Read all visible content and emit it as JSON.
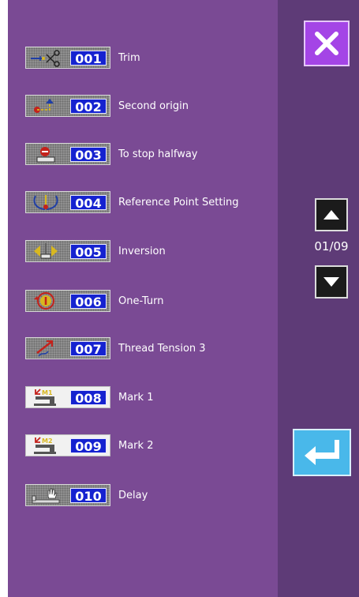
{
  "list": {
    "items": [
      {
        "code": "001",
        "label": "Trim",
        "icon": "scissors-icon"
      },
      {
        "code": "002",
        "label": "Second origin",
        "icon": "second-origin-icon"
      },
      {
        "code": "003",
        "label": "To stop halfway",
        "icon": "stop-halfway-icon"
      },
      {
        "code": "004",
        "label": "Reference Point Setting",
        "icon": "reference-point-icon"
      },
      {
        "code": "005",
        "label": "Inversion",
        "icon": "inversion-icon"
      },
      {
        "code": "006",
        "label": "One-Turn",
        "icon": "one-turn-icon"
      },
      {
        "code": "007",
        "label": "Thread Tension 3",
        "icon": "thread-tension-icon"
      },
      {
        "code": "008",
        "label": "Mark 1",
        "icon": "mark1-icon"
      },
      {
        "code": "009",
        "label": "Mark 2",
        "icon": "mark2-icon"
      },
      {
        "code": "010",
        "label": "Delay",
        "icon": "delay-icon"
      }
    ]
  },
  "icon_labels": {
    "mark1": "M1",
    "mark2": "M2"
  },
  "pagination": {
    "indicator": "01/09"
  },
  "colors": {
    "panel": "#7a4a94",
    "side_panel": "#5e3b77",
    "code_bg": "#1522d0",
    "close": "#a445e6",
    "enter": "#49b8ea"
  }
}
